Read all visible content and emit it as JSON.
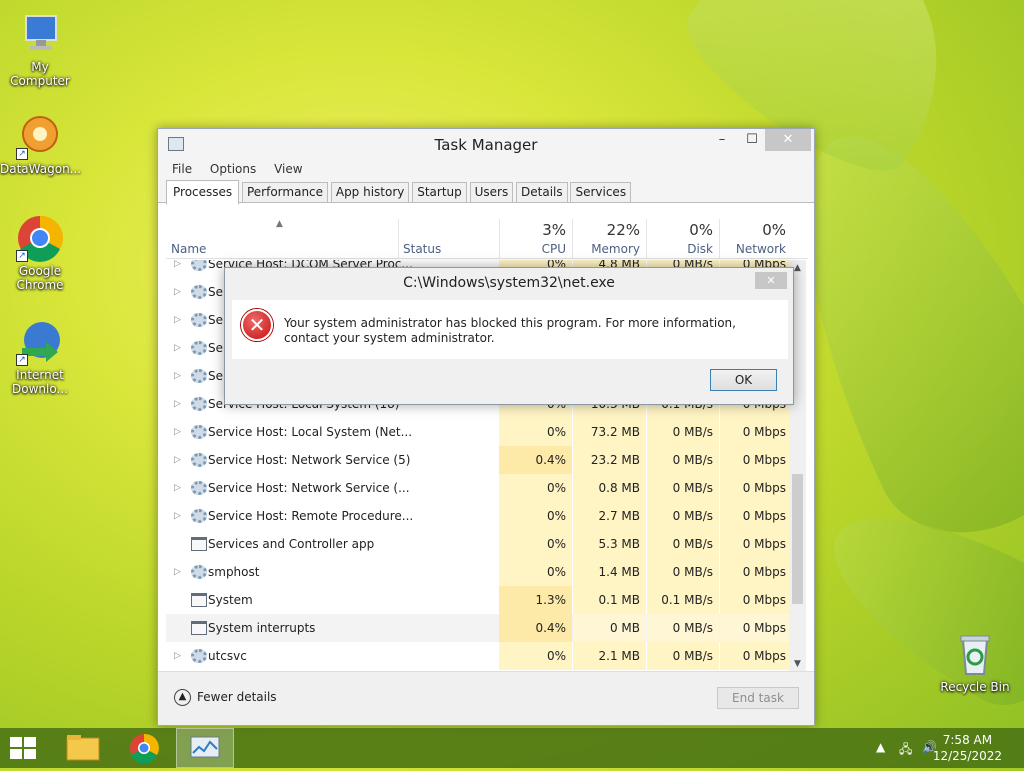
{
  "desktop": {
    "icons": [
      {
        "label": "My Computer"
      },
      {
        "label": "DataWagon..."
      },
      {
        "label": "Google Chrome"
      },
      {
        "label": "Internet Downlo..."
      },
      {
        "label": "Recycle Bin"
      }
    ]
  },
  "taskmanager": {
    "title": "Task Manager",
    "window_buttons": {
      "minimize": "–",
      "maximize": "☐",
      "close": "✕"
    },
    "menu": [
      "File",
      "Options",
      "View"
    ],
    "tabs": [
      "Processes",
      "Performance",
      "App history",
      "Startup",
      "Users",
      "Details",
      "Services"
    ],
    "active_tab": "Processes",
    "columns": {
      "name": "Name",
      "status": "Status",
      "cpu": {
        "pct": "3%",
        "label": "CPU"
      },
      "memory": {
        "pct": "22%",
        "label": "Memory"
      },
      "disk": {
        "pct": "0%",
        "label": "Disk"
      },
      "network": {
        "pct": "0%",
        "label": "Network"
      }
    },
    "rows": [
      {
        "name": "Service Host: DCOM Server Proc...",
        "cpu": "0%",
        "mem": "4.8 MB",
        "disk": "0 MB/s",
        "net": "0 Mbps",
        "expand": true,
        "icon": "gear"
      },
      {
        "name": "Se",
        "cpu": "",
        "mem": "",
        "disk": "",
        "net": "",
        "expand": true,
        "icon": "gear"
      },
      {
        "name": "Se",
        "cpu": "",
        "mem": "",
        "disk": "",
        "net": "",
        "expand": true,
        "icon": "gear"
      },
      {
        "name": "Se",
        "cpu": "",
        "mem": "",
        "disk": "",
        "net": "",
        "expand": true,
        "icon": "gear"
      },
      {
        "name": "Se",
        "cpu": "",
        "mem": "",
        "disk": "",
        "net": "",
        "expand": true,
        "icon": "gear"
      },
      {
        "name": "Service Host: Local System (18)",
        "cpu": "0%",
        "mem": "10.3 MB",
        "disk": "0.1 MB/s",
        "net": "0 Mbps",
        "expand": true,
        "icon": "gear"
      },
      {
        "name": "Service Host: Local System (Net...",
        "cpu": "0%",
        "mem": "73.2 MB",
        "disk": "0 MB/s",
        "net": "0 Mbps",
        "expand": true,
        "icon": "gear"
      },
      {
        "name": "Service Host: Network Service (5)",
        "cpu": "0.4%",
        "mem": "23.2 MB",
        "disk": "0 MB/s",
        "net": "0 Mbps",
        "expand": true,
        "icon": "gear"
      },
      {
        "name": "Service Host: Network Service (...",
        "cpu": "0%",
        "mem": "0.8 MB",
        "disk": "0 MB/s",
        "net": "0 Mbps",
        "expand": true,
        "icon": "gear"
      },
      {
        "name": "Service Host: Remote Procedure...",
        "cpu": "0%",
        "mem": "2.7 MB",
        "disk": "0 MB/s",
        "net": "0 Mbps",
        "expand": true,
        "icon": "gear"
      },
      {
        "name": "Services and Controller app",
        "cpu": "0%",
        "mem": "5.3 MB",
        "disk": "0 MB/s",
        "net": "0 Mbps",
        "expand": false,
        "icon": "app"
      },
      {
        "name": "smphost",
        "cpu": "0%",
        "mem": "1.4 MB",
        "disk": "0 MB/s",
        "net": "0 Mbps",
        "expand": true,
        "icon": "gear"
      },
      {
        "name": "System",
        "cpu": "1.3%",
        "mem": "0.1 MB",
        "disk": "0.1 MB/s",
        "net": "0 Mbps",
        "expand": false,
        "icon": "app"
      },
      {
        "name": "System interrupts",
        "cpu": "0.4%",
        "mem": "0 MB",
        "disk": "0 MB/s",
        "net": "0 Mbps",
        "expand": false,
        "icon": "app",
        "selected": true
      },
      {
        "name": "utcsvc",
        "cpu": "0%",
        "mem": "2.1 MB",
        "disk": "0 MB/s",
        "net": "0 Mbps",
        "expand": true,
        "icon": "gear"
      }
    ],
    "footer": {
      "fewer_details": "Fewer details",
      "end_task": "End task"
    }
  },
  "dialog": {
    "title": "C:\\Windows\\system32\\net.exe",
    "message": "Your system administrator has blocked this program. For more information, contact your system administrator.",
    "ok": "OK",
    "close": "✕"
  },
  "taskbar": {
    "time": "7:58 AM",
    "date": "12/25/2022"
  }
}
